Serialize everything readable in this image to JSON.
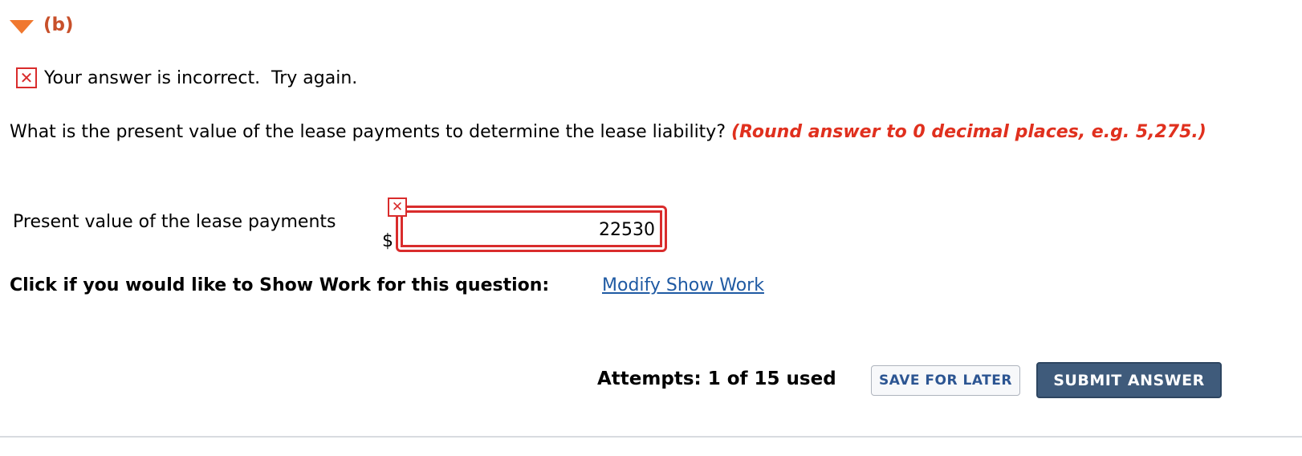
{
  "section": {
    "label": "(b)",
    "toggle_icon": "triangle-down-icon",
    "accent_color": "#f0782f"
  },
  "feedback": {
    "icon": "x-mark-icon",
    "text": "Your answer is incorrect.  Try again.",
    "color": "#d92c2c"
  },
  "question": {
    "text": "What is the present value of the lease payments to determine the lease liability? ",
    "hint": "(Round answer to 0 decimal places, e.g. 5,275.)",
    "hint_color": "#e0301e"
  },
  "answer": {
    "label": "Present value of the lease payments",
    "currency": "$",
    "value": "22530",
    "status_icon": "x-mark-icon"
  },
  "show_work": {
    "prompt": "Click if you would like to Show Work for this question:",
    "link": "Modify Show Work"
  },
  "footer": {
    "attempts": "Attempts: 1 of 15 used",
    "save_label": "SAVE FOR LATER",
    "submit_label": "SUBMIT ANSWER",
    "submit_color": "#3f5b7b"
  }
}
